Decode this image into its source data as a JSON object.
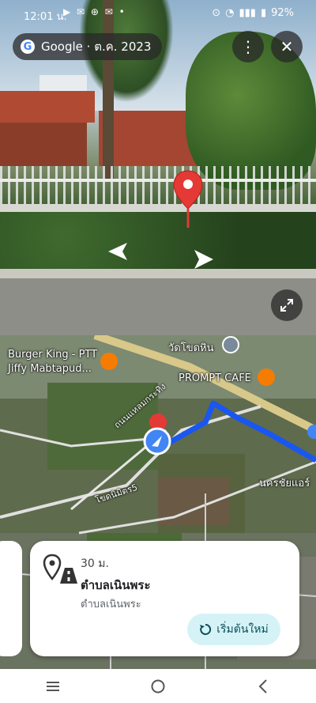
{
  "status_bar": {
    "time": "12:01 น.",
    "left_icons": "▶ ✉ ⊕ ✉ •",
    "battery": "92%"
  },
  "street_view": {
    "source": "Google",
    "date": "ต.ค. 2023",
    "pill_text": "Google · ต.ค. 2023"
  },
  "map": {
    "labels": {
      "burger_king_line1": "Burger King - PTT",
      "burger_king_line2": "Jiffy Mabtapud...",
      "wat": "วัดโขดหิน",
      "cafe": "PROMPT CAFE",
      "road1": "ถนนแหลมกระทิง",
      "road2": "โขดนิมิตร5",
      "nakhon": "นครชัยแอร์"
    },
    "colors": {
      "route": "#1a56f0",
      "pin": "#e53935",
      "location": "#4285f4"
    }
  },
  "card": {
    "distance": "30 ม.",
    "title": "ตำบลเนินพระ",
    "subtitle": "ตำบลเนินพระ",
    "restart_label": "เริ่มต้นใหม่"
  },
  "icons": {
    "more": "more-vert-icon",
    "close": "close-icon",
    "expand": "expand-icon",
    "restart": "restart-icon",
    "place": "place-road-icon"
  }
}
